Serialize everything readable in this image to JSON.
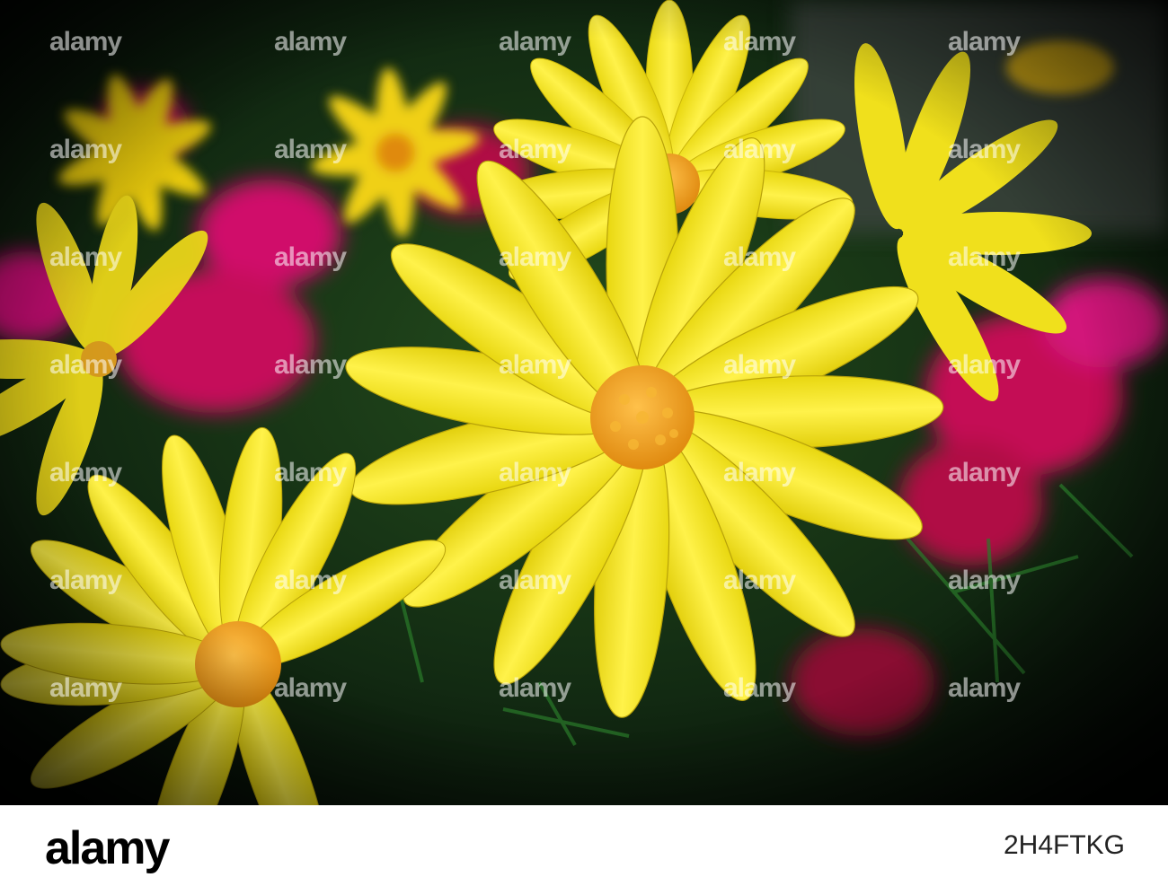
{
  "image": {
    "subject": "yellow daisy flowers with pink blossoms",
    "colors": {
      "petal": "#f2e21a",
      "petal_shadow": "#c9b40a",
      "center": "#f0a21e",
      "foliage": "#1f5a22",
      "pink": "#d0106a",
      "background": "#0a0f0a"
    }
  },
  "watermark": {
    "text": "alamy"
  },
  "footer": {
    "logo": "alamy",
    "image_id": "2H4FTKG"
  }
}
